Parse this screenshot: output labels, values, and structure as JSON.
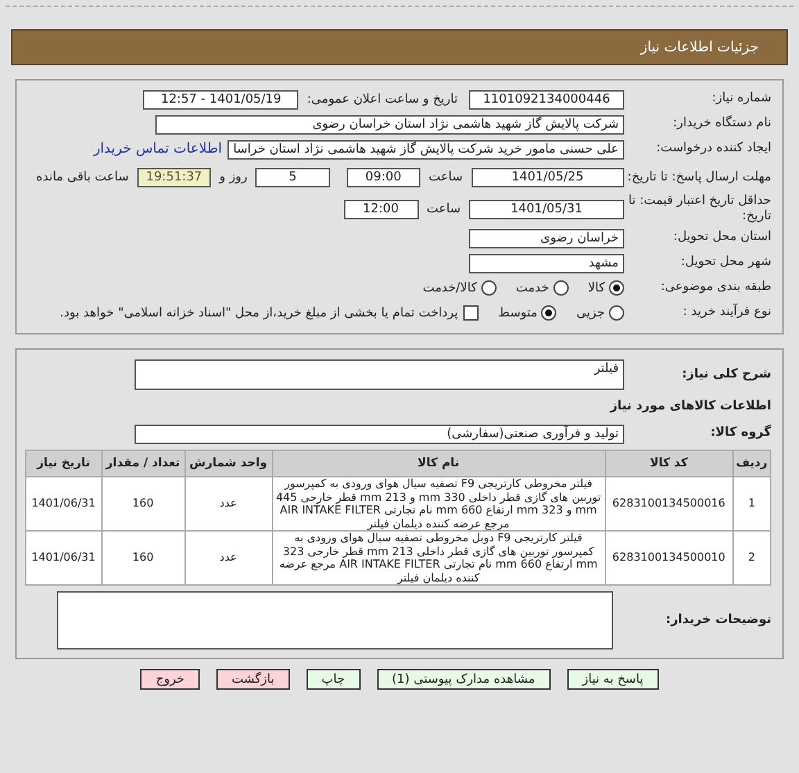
{
  "header": {
    "title": "جزئیات اطلاعات نیاز"
  },
  "details": {
    "need_number": {
      "label": "شماره نیاز:",
      "value": "1101092134000446"
    },
    "announce": {
      "label": "تاریخ و ساعت اعلان عمومی:",
      "value": "1401/05/19 - 12:57"
    },
    "buyer": {
      "label": "نام دستگاه خریدار:",
      "value": "شرکت پالایش گاز شهید هاشمی نژاد   استان خراسان رضوی"
    },
    "creator": {
      "label": "ایجاد کننده درخواست:",
      "value": "علی حسنی مامور خرید شرکت پالایش گاز شهید هاشمی نژاد   استان خراسا",
      "link": "اطلاعات تماس خریدار"
    },
    "deadline": {
      "label": "مهلت ارسال پاسخ: تا تاریخ:",
      "date": "1401/05/25",
      "time_label": "ساعت",
      "time": "09:00",
      "days": "5",
      "days_label": "روز و",
      "remaining": "19:51:37",
      "remaining_label": "ساعت باقی مانده"
    },
    "validity": {
      "label": "حداقل تاریخ اعتبار قیمت: تا تاریخ:",
      "date": "1401/05/31",
      "time_label": "ساعت",
      "time": "12:00"
    },
    "province": {
      "label": "استان محل تحویل:",
      "value": "خراسان رضوی"
    },
    "city": {
      "label": "شهر محل تحویل:",
      "value": "مشهد"
    },
    "category": {
      "label": "طبقه بندی موضوعی:",
      "options": [
        {
          "label": "کالا",
          "selected": true
        },
        {
          "label": "خدمت",
          "selected": false
        },
        {
          "label": "کالا/خدمت",
          "selected": false
        }
      ]
    },
    "process": {
      "label": "نوع فرآیند خرید :",
      "options": [
        {
          "label": "جزیی",
          "selected": false
        },
        {
          "label": "متوسط",
          "selected": true
        }
      ],
      "payment": {
        "label": "پرداخت تمام یا بخشی از مبلغ خرید،از محل \"اسناد خزانه اسلامی\" خواهد بود.",
        "checked": false
      }
    }
  },
  "needs": {
    "description": {
      "label": "شرح کلی نیاز:",
      "value": "فیلتر"
    },
    "section_title": "اطلاعات کالاهای مورد نیاز",
    "group": {
      "label": "گروه کالا:",
      "value": "تولید و فرآوری صنعتی(سفارشی)"
    },
    "table": {
      "columns": [
        "ردیف",
        "کد کالا",
        "نام کالا",
        "واحد شمارش",
        "تعداد / مقدار",
        "تاریخ نیاز"
      ],
      "rows": [
        [
          "1",
          "6283100134500016",
          "فیلتر مخروطی کارتریجی F9 تصفیه سیال هوای ورودی به کمپرسور توربین های گازی قطر داخلی 330 mm و 213 mm قطر خارجی 445 mm و 323 mm ارتفاع 660 mm نام تجارتی AIR INTAKE FILTER مرجع عرضه کننده دیلمان فیلتر",
          "عدد",
          "160",
          "1401/06/31"
        ],
        [
          "2",
          "6283100134500010",
          "فیلتر کارتریجی F9 دوبل مخروطی تصفیه سیال هوای ورودی به کمپرسور توربین های گازی قطر داخلی 213 mm قطر خارجی 323 mm ارتفاع 660 mm نام تجارتی AIR INTAKE FILTER مرجع عرضه کننده دیلمان فیلتر",
          "عدد",
          "160",
          "1401/06/31"
        ]
      ]
    },
    "notes": {
      "label": "توضیحات خریدار:"
    }
  },
  "buttons": [
    {
      "label": "پاسخ به نیاز",
      "color": "#e6fae6"
    },
    {
      "label": "مشاهده مدارک پیوستی (1)",
      "color": "#e6fae6"
    },
    {
      "label": "چاپ",
      "color": "#e6fae6"
    },
    {
      "label": "بازگشت",
      "color": "#fbd3d8"
    },
    {
      "label": "خروج",
      "color": "#fbd3d8"
    }
  ]
}
